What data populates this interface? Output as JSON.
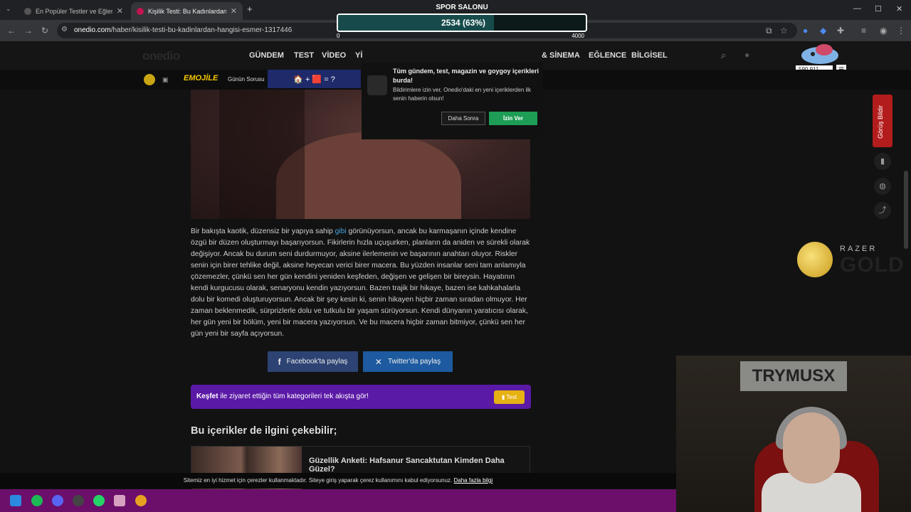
{
  "browser": {
    "tabs": [
      {
        "title": "En Popüler Testler ve Eğlenceli"
      },
      {
        "title": "Kişilik Testi: Bu Kadınlardan Han"
      }
    ],
    "new_tab": "+",
    "url_host": "onedio.com",
    "url_path": "/haber/kisilik-testi-bu-kadinlardan-hangisi-esmer-1317446",
    "window_controls": {
      "minimize": "—",
      "maximize": "☐",
      "close": "✕"
    }
  },
  "site": {
    "logo": "onedio",
    "menu": [
      "GÜNDEM",
      "TEST",
      "VİDEO",
      "Yİ",
      "& SİNEMA",
      "EĞLENCE",
      "BİLGİSEL"
    ],
    "follower_count": "590 911",
    "subbar": {
      "emojile": "EMOJİLE",
      "gunun_sorusu": "Günün Sorusu",
      "quiz": "🏠 + 🟥 = ?"
    }
  },
  "notification": {
    "title": "Tüm gündem, test, magazin ve goygoy içerikleri burda!",
    "body": "Bildirimlere izin ver, Onedio'daki en yeni içeriklerden ilk senin haberin olsun!",
    "later": "Daha Sonra",
    "allow": "İzin Ver"
  },
  "article": {
    "para_before_link": "Bir bakışta kaotik, düzensiz bir yapıya sahip ",
    "link": "gibi",
    "para_after_link": " görünüyorsun, ancak bu karmaşanın içinde kendine özgü bir düzen oluşturmayı başarıyorsun. Fikirlerin hızla uçuşurken, planların da aniden ve sürekli olarak değişiyor. Ancak bu durum seni durdurmuyor, aksine ilerlemenin ve başarının anahtarı oluyor. Riskler senin için birer tehlike değil, aksine heyecan verici birer macera. Bu yüzden insanlar seni tam anlamıyla çözemezler, çünkü sen her gün kendini yeniden keşfeden, değişen ve gelişen bir bireysin. Hayatının kendi kurgucusu olarak, senaryonu kendin yazıyorsun. Bazen trajik bir hikaye, bazen ise kahkahalarla dolu bir komedi oluşturuyorsun. Ancak bir şey kesin ki, senin hikayen hiçbir zaman sıradan olmuyor. Her zaman beklenmedik, sürprizlerle dolu ve tutkulu bir yaşam sürüyorsun. Kendi dünyanın yaratıcısı olarak, her gün yeni bir bölüm, yeni bir macera yazıyorsun. Ve bu macera hiçbir zaman bitmiyor, çünkü sen her gün yeni bir sayfa açıyorsun.",
    "share_facebook": "Facebook'ta paylaş",
    "share_twitter": "Twitter'da paylaş",
    "kesfet_bold": "Keşfet",
    "kesfet_text": " ile ziyaret ettiğin tüm kategorileri tek akışta gör!",
    "kesfet_badge": "Test",
    "related_heading": "Bu içerikler de ilgini çekebilir;",
    "related_title": "Güzellik Anketi: Hafsanur Sancaktutan Kimden Daha Güzel?"
  },
  "cookie": {
    "text": "Sitemiz en iyi hizmet için çerezler kullanmaktadır. Siteye giriş yaparak çerez kullanımını kabul ediyorsunuz. ",
    "link": "Daha fazla bilgi"
  },
  "sidebar": {
    "feedback": "Görüş Bildir"
  },
  "ad": {
    "brand": "RAZER",
    "product": "GOLD"
  },
  "overlay": {
    "label": "SPOR SALONU",
    "value_text": "2534 (63%)",
    "progress": 0.63,
    "min": "0",
    "max": "4000",
    "webcam_sign": "TRYMUSX"
  },
  "colors": {
    "accent_green": "#1d9d55",
    "kesfet_purple": "#5b1aa6",
    "feedback_red": "#b31c1c",
    "taskbar": "#6b0f6b"
  }
}
